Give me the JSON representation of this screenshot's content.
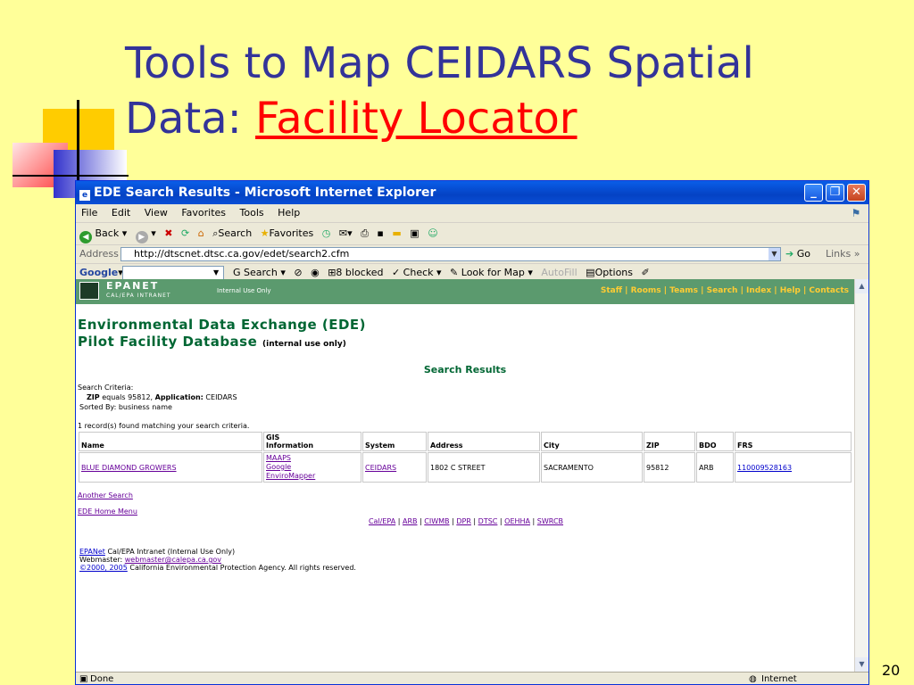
{
  "slide": {
    "title_line1": "Tools to Map CEIDARS Spatial",
    "title_line2_prefix": "Data: ",
    "title_line2_accent": "Facility Locator",
    "page_number": "20"
  },
  "browser": {
    "window_title": "EDE Search Results - Microsoft Internet Explorer",
    "menu": [
      "File",
      "Edit",
      "View",
      "Favorites",
      "Tools",
      "Help"
    ],
    "toolbar": {
      "back": "Back",
      "search": "Search",
      "favorites": "Favorites"
    },
    "address_label": "Address",
    "address_value": "http://dtscnet.dtsc.ca.gov/edet/search2.cfm",
    "go_label": "Go",
    "links_label": "Links",
    "google": {
      "logo": "Google",
      "search": "Search",
      "blocked": "8 blocked",
      "check": "Check",
      "look_for_map": "Look for Map",
      "autofill": "AutoFill",
      "options": "Options"
    },
    "status_left": "Done",
    "status_zone": "Internet"
  },
  "page": {
    "header": {
      "brand": "EPANET",
      "brand_sub": "CAL/EPA INTRANET",
      "internal": "Internal Use Only",
      "nav": [
        "Staff",
        "Rooms",
        "Teams",
        "Search",
        "Index",
        "Help",
        "Contacts"
      ]
    },
    "title_line1": "Environmental Data Exchange (EDE)",
    "title_line2": "Pilot Facility Database",
    "title_line2_note": "(internal use only)",
    "results_heading": "Search Results",
    "criteria_label": "Search Criteria:",
    "criteria_zip_key": "ZIP",
    "criteria_zip_text": "equals 95812,",
    "criteria_app_key": "Application:",
    "criteria_app_val": "CEIDARS",
    "sorted_by": "Sorted By: business name",
    "records_found": "1 record(s) found matching your search criteria.",
    "table": {
      "headers": [
        "Name",
        "GIS Information",
        "System",
        "Address",
        "City",
        "ZIP",
        "BDO",
        "FRS"
      ],
      "gis_header_line1": "GIS",
      "gis_header_line2": "Information",
      "row": {
        "name": "BLUE DIAMOND GROWERS",
        "gis_links": [
          "MAAPS",
          "Google",
          "EnviroMapper"
        ],
        "system": "CEIDARS",
        "address": "1802 C STREET",
        "city": "SACRAMENTO",
        "zip": "95812",
        "bdo": "ARB",
        "frs": "110009528163"
      }
    },
    "another_search": "Another Search",
    "home_menu": "EDE Home Menu",
    "agency_links": [
      "Cal/EPA",
      "ARB",
      "CIWMB",
      "DPR",
      "DTSC",
      "OEHHA",
      "SWRCB"
    ],
    "footer": {
      "epanet_link": "EPANet",
      "epanet_text": "Cal/EPA Intranet (Internal Use Only)",
      "webmaster_label": "Webmaster:",
      "webmaster_email": "webmaster@calepa.ca.gov",
      "copyright_link": "©2000, 2005",
      "copyright_text": "California Environmental Protection Agency.  All rights reserved."
    }
  },
  "colors": {
    "slide_bg": "#ffff99",
    "title_blue": "#333399",
    "title_red": "#ff0000",
    "epanet_green": "#5b9a6e",
    "ede_green": "#006633"
  }
}
